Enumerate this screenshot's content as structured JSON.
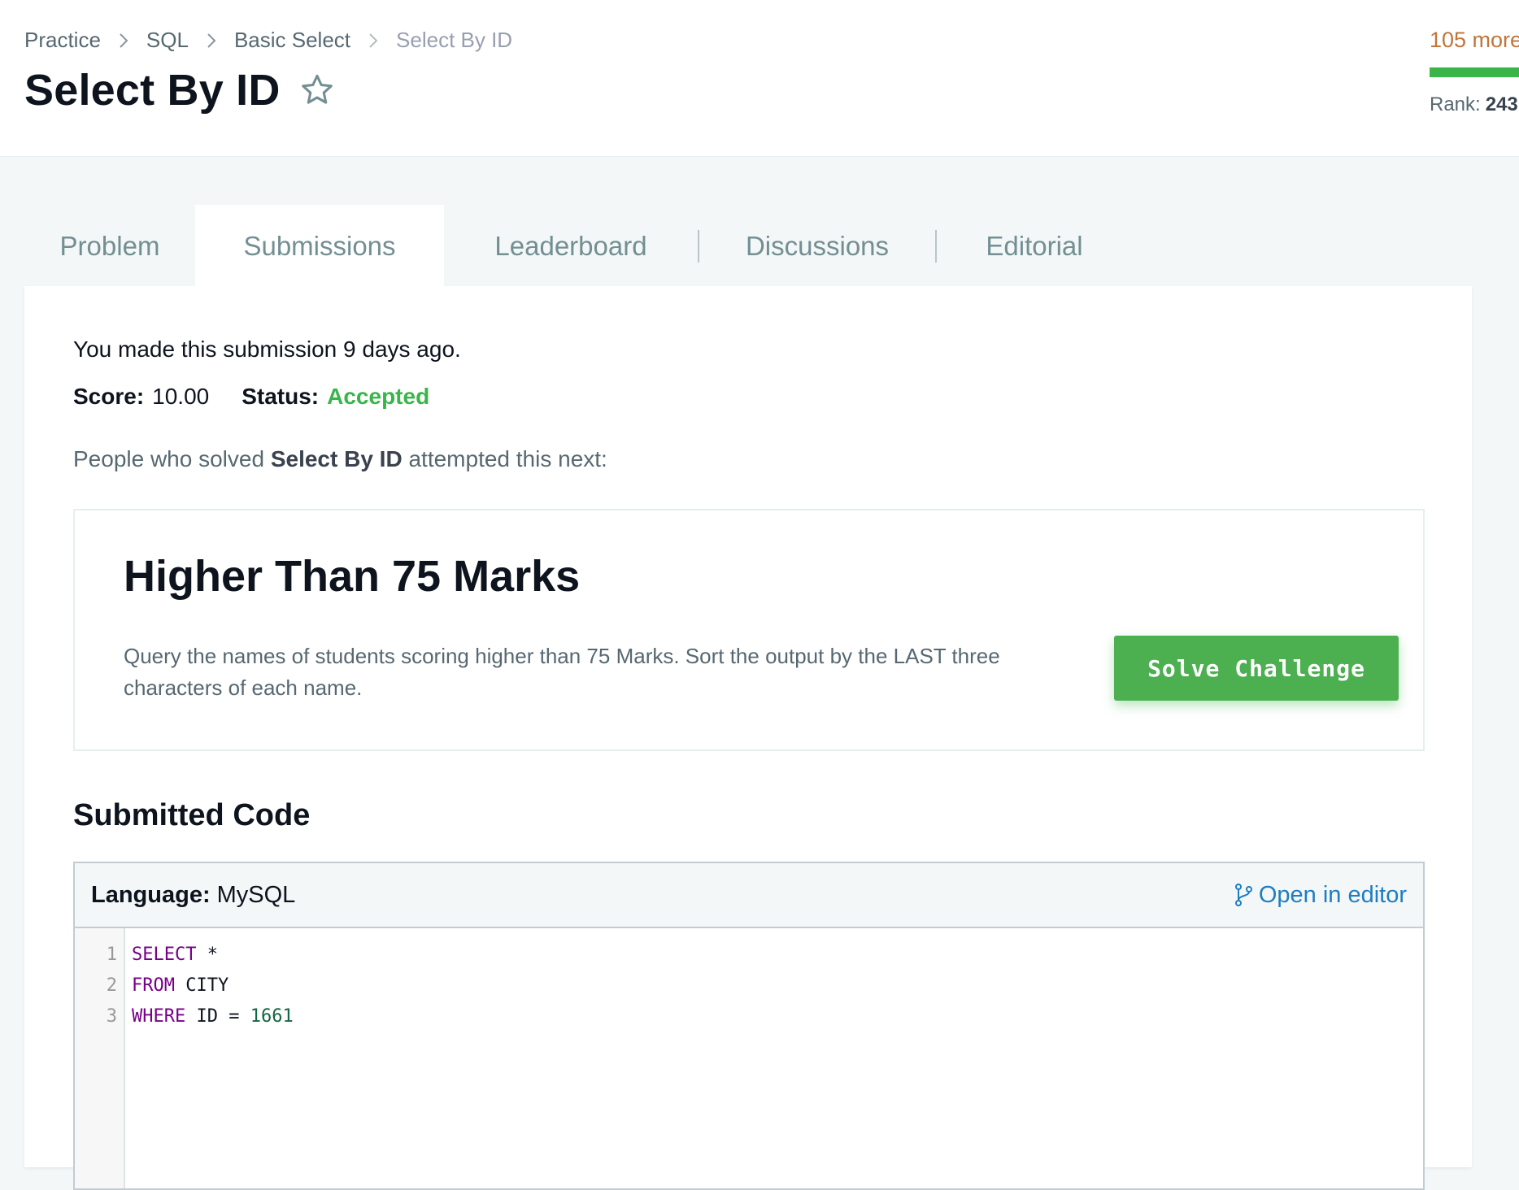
{
  "breadcrumb": {
    "items": [
      "Practice",
      "SQL",
      "Basic Select"
    ],
    "current": "Select By ID"
  },
  "page": {
    "title": "Select By ID"
  },
  "profile": {
    "points_more": "105 more",
    "progress_fraction": 1.0,
    "rank_label": "Rank:",
    "rank_value": "243"
  },
  "tabs": [
    {
      "label": "Problem",
      "active": false
    },
    {
      "label": "Submissions",
      "active": true
    },
    {
      "label": "Leaderboard",
      "active": false
    },
    {
      "label": "Discussions",
      "active": false
    },
    {
      "label": "Editorial",
      "active": false
    }
  ],
  "submission": {
    "note": "You made this submission 9 days ago.",
    "score_label": "Score:",
    "score_value": "10.00",
    "status_label": "Status:",
    "status_value": "Accepted",
    "status_color": "#39b54a"
  },
  "next": {
    "intro_prefix": "People who solved ",
    "intro_challenge": "Select By ID",
    "intro_suffix": " attempted this next:",
    "title": "Higher Than 75 Marks",
    "description": "Query the names of students scoring higher than 75 Marks. Sort the output by the LAST three characters of each name.",
    "button_label": "Solve Challenge",
    "button_color": "#4caf50"
  },
  "code": {
    "heading": "Submitted Code",
    "language_label": "Language:",
    "language_value": "MySQL",
    "open_in_editor": "Open in editor",
    "lines": [
      {
        "no": "1",
        "kw": "SELECT",
        "rest": " *",
        "num": ""
      },
      {
        "no": "2",
        "kw": "FROM",
        "rest": " CITY",
        "num": ""
      },
      {
        "no": "3",
        "kw": "WHERE",
        "rest": " ID = ",
        "num": "1661"
      }
    ]
  },
  "icons": {
    "breadcrumb_separator": "chevron-right-icon",
    "favorite": "star-icon",
    "open_editor": "git-branch-icon"
  }
}
